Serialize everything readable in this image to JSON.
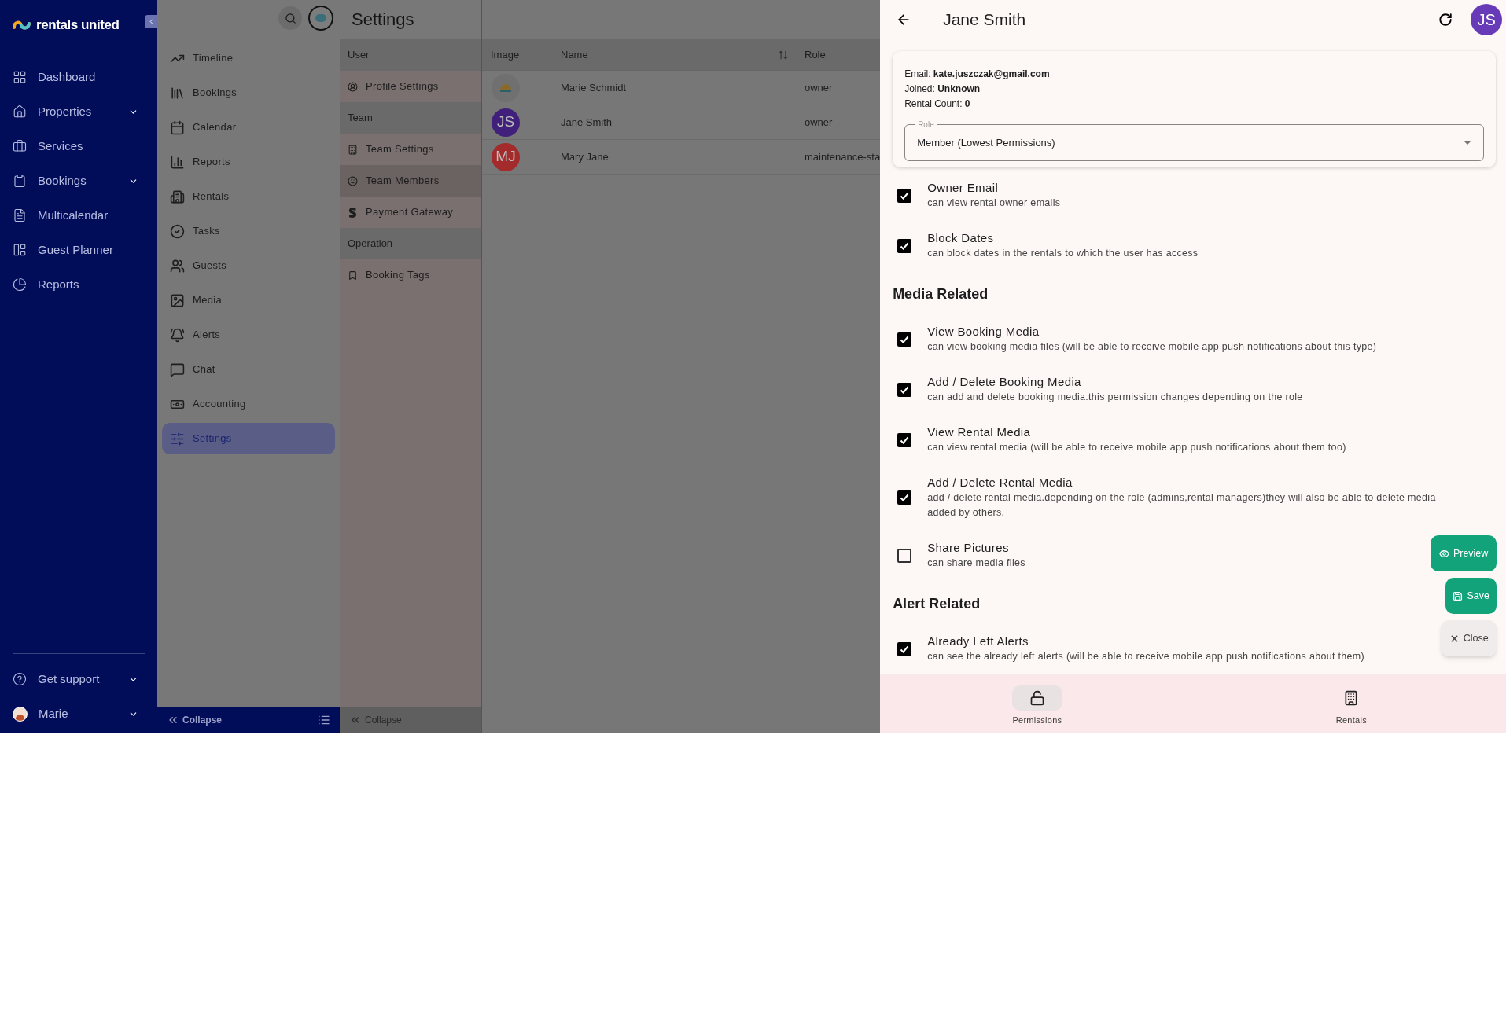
{
  "brand": {
    "name": "rentals united"
  },
  "main_nav": [
    {
      "label": "Dashboard",
      "submenu": false
    },
    {
      "label": "Properties",
      "submenu": true
    },
    {
      "label": "Services",
      "submenu": false
    },
    {
      "label": "Bookings",
      "submenu": true
    },
    {
      "label": "Multicalendar",
      "submenu": false
    },
    {
      "label": "Guest Planner",
      "submenu": false
    },
    {
      "label": "Reports",
      "submenu": false
    }
  ],
  "main_footer": [
    {
      "kind": "support",
      "label": "Get support"
    },
    {
      "kind": "user",
      "label": "Marie"
    }
  ],
  "app_nav": {
    "items": [
      {
        "label": "Timeline",
        "selected": false
      },
      {
        "label": "Bookings",
        "selected": false
      },
      {
        "label": "Calendar",
        "selected": false
      },
      {
        "label": "Reports",
        "selected": false
      },
      {
        "label": "Rentals",
        "selected": false
      },
      {
        "label": "Tasks",
        "selected": false
      },
      {
        "label": "Guests",
        "selected": false
      },
      {
        "label": "Media",
        "selected": false
      },
      {
        "label": "Alerts",
        "selected": false
      },
      {
        "label": "Chat",
        "selected": false
      },
      {
        "label": "Accounting",
        "selected": false
      },
      {
        "label": "Settings",
        "selected": true
      }
    ],
    "collapse": "Collapse"
  },
  "settings": {
    "title": "Settings",
    "sections": [
      {
        "heading": "User",
        "items": [
          {
            "label": "Profile Settings",
            "selected": false
          }
        ]
      },
      {
        "heading": "Team",
        "items": [
          {
            "label": "Team Settings",
            "selected": false
          },
          {
            "label": "Team Members",
            "selected": true
          },
          {
            "label": "Payment Gateway",
            "selected": false
          }
        ]
      },
      {
        "heading": "Operation",
        "items": [
          {
            "label": "Booking Tags",
            "selected": false
          }
        ]
      }
    ],
    "collapse": "Collapse"
  },
  "table": {
    "columns": [
      "Image",
      "Name",
      "Role"
    ],
    "rows": [
      {
        "kind": "image",
        "name": "Marie Schmidt",
        "role": "owner"
      },
      {
        "kind": "initials",
        "initials": "JS",
        "color": "#40207a",
        "name": "Jane Smith",
        "role": "owner"
      },
      {
        "kind": "initials",
        "initials": "MJ",
        "color": "#a32b2b",
        "name": "Mary Jane",
        "role": "maintenance-sta"
      }
    ]
  },
  "panel": {
    "title": "Jane Smith",
    "avatar": "JS",
    "info": [
      "Email: **kate.juszczak@gmail.com**",
      "Joined: **Unknown**",
      "Rental Count: **0**"
    ],
    "role_field": {
      "label": "Role",
      "value": "Member (Lowest Permissions)"
    },
    "permissions": [
      {
        "kind": "checkbox",
        "title": "Owner Email",
        "description": "can view rental owner emails",
        "checked": true
      },
      {
        "kind": "checkbox",
        "title": "Block Dates",
        "description": "can block dates in the rentals to which the user has access",
        "checked": true
      },
      {
        "kind": "heading",
        "title": "Media Related"
      },
      {
        "kind": "checkbox",
        "title": "View Booking Media",
        "description": "can view booking media files (will be able to receive mobile app push notifications about this type)",
        "checked": true
      },
      {
        "kind": "checkbox",
        "title": "Add / Delete Booking Media",
        "description": "can add and delete booking media.this permission changes depending on the role",
        "checked": true
      },
      {
        "kind": "checkbox",
        "title": "View Rental Media",
        "description": "can view rental media (will be able to receive mobile app push notifications about them too)",
        "checked": true
      },
      {
        "kind": "checkbox",
        "title": "Add / Delete Rental Media",
        "description": "add / delete rental media.depending on the role (admins,rental managers)they will also be able to delete media added by others.",
        "checked": true
      },
      {
        "kind": "checkbox",
        "title": "Share Pictures",
        "description": "can share media files",
        "checked": false
      },
      {
        "kind": "heading",
        "title": "Alert Related"
      },
      {
        "kind": "checkbox",
        "title": "Already Left Alerts",
        "description": "can see the already left alerts (will be able to receive mobile app push notifications about them)",
        "checked": true
      }
    ],
    "actions": [
      {
        "kind": "preview",
        "label": "Preview"
      },
      {
        "kind": "save",
        "label": "Save"
      },
      {
        "kind": "close",
        "label": "Close"
      }
    ],
    "tabs": [
      {
        "label": "Permissions",
        "selected": true
      },
      {
        "label": "Rentals",
        "selected": false
      }
    ]
  }
}
